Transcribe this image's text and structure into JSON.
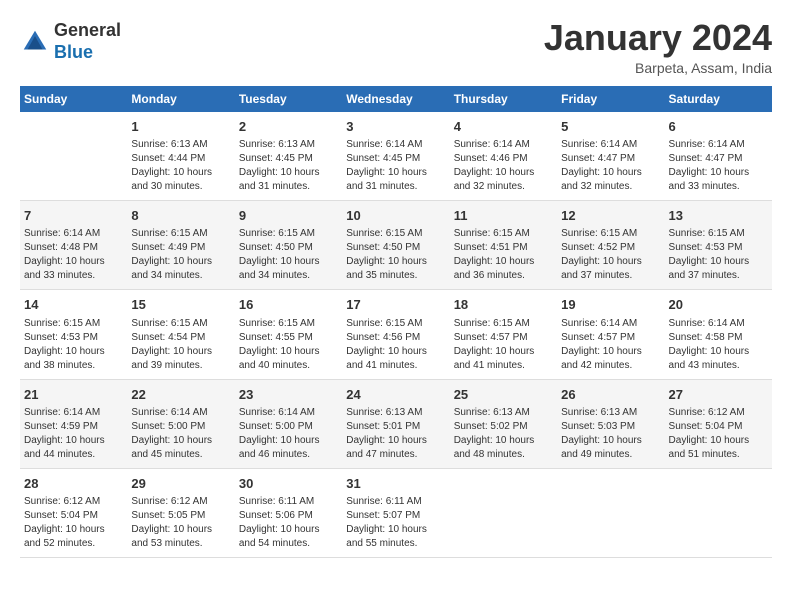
{
  "header": {
    "logo": {
      "general": "General",
      "blue": "Blue"
    },
    "title": "January 2024",
    "location": "Barpeta, Assam, India"
  },
  "calendar": {
    "days_of_week": [
      "Sunday",
      "Monday",
      "Tuesday",
      "Wednesday",
      "Thursday",
      "Friday",
      "Saturday"
    ],
    "weeks": [
      [
        {
          "day": "",
          "sunrise": "",
          "sunset": "",
          "daylight": ""
        },
        {
          "day": "1",
          "sunrise": "Sunrise: 6:13 AM",
          "sunset": "Sunset: 4:44 PM",
          "daylight": "Daylight: 10 hours and 30 minutes."
        },
        {
          "day": "2",
          "sunrise": "Sunrise: 6:13 AM",
          "sunset": "Sunset: 4:45 PM",
          "daylight": "Daylight: 10 hours and 31 minutes."
        },
        {
          "day": "3",
          "sunrise": "Sunrise: 6:14 AM",
          "sunset": "Sunset: 4:45 PM",
          "daylight": "Daylight: 10 hours and 31 minutes."
        },
        {
          "day": "4",
          "sunrise": "Sunrise: 6:14 AM",
          "sunset": "Sunset: 4:46 PM",
          "daylight": "Daylight: 10 hours and 32 minutes."
        },
        {
          "day": "5",
          "sunrise": "Sunrise: 6:14 AM",
          "sunset": "Sunset: 4:47 PM",
          "daylight": "Daylight: 10 hours and 32 minutes."
        },
        {
          "day": "6",
          "sunrise": "Sunrise: 6:14 AM",
          "sunset": "Sunset: 4:47 PM",
          "daylight": "Daylight: 10 hours and 33 minutes."
        }
      ],
      [
        {
          "day": "7",
          "sunrise": "Sunrise: 6:14 AM",
          "sunset": "Sunset: 4:48 PM",
          "daylight": "Daylight: 10 hours and 33 minutes."
        },
        {
          "day": "8",
          "sunrise": "Sunrise: 6:15 AM",
          "sunset": "Sunset: 4:49 PM",
          "daylight": "Daylight: 10 hours and 34 minutes."
        },
        {
          "day": "9",
          "sunrise": "Sunrise: 6:15 AM",
          "sunset": "Sunset: 4:50 PM",
          "daylight": "Daylight: 10 hours and 34 minutes."
        },
        {
          "day": "10",
          "sunrise": "Sunrise: 6:15 AM",
          "sunset": "Sunset: 4:50 PM",
          "daylight": "Daylight: 10 hours and 35 minutes."
        },
        {
          "day": "11",
          "sunrise": "Sunrise: 6:15 AM",
          "sunset": "Sunset: 4:51 PM",
          "daylight": "Daylight: 10 hours and 36 minutes."
        },
        {
          "day": "12",
          "sunrise": "Sunrise: 6:15 AM",
          "sunset": "Sunset: 4:52 PM",
          "daylight": "Daylight: 10 hours and 37 minutes."
        },
        {
          "day": "13",
          "sunrise": "Sunrise: 6:15 AM",
          "sunset": "Sunset: 4:53 PM",
          "daylight": "Daylight: 10 hours and 37 minutes."
        }
      ],
      [
        {
          "day": "14",
          "sunrise": "Sunrise: 6:15 AM",
          "sunset": "Sunset: 4:53 PM",
          "daylight": "Daylight: 10 hours and 38 minutes."
        },
        {
          "day": "15",
          "sunrise": "Sunrise: 6:15 AM",
          "sunset": "Sunset: 4:54 PM",
          "daylight": "Daylight: 10 hours and 39 minutes."
        },
        {
          "day": "16",
          "sunrise": "Sunrise: 6:15 AM",
          "sunset": "Sunset: 4:55 PM",
          "daylight": "Daylight: 10 hours and 40 minutes."
        },
        {
          "day": "17",
          "sunrise": "Sunrise: 6:15 AM",
          "sunset": "Sunset: 4:56 PM",
          "daylight": "Daylight: 10 hours and 41 minutes."
        },
        {
          "day": "18",
          "sunrise": "Sunrise: 6:15 AM",
          "sunset": "Sunset: 4:57 PM",
          "daylight": "Daylight: 10 hours and 41 minutes."
        },
        {
          "day": "19",
          "sunrise": "Sunrise: 6:14 AM",
          "sunset": "Sunset: 4:57 PM",
          "daylight": "Daylight: 10 hours and 42 minutes."
        },
        {
          "day": "20",
          "sunrise": "Sunrise: 6:14 AM",
          "sunset": "Sunset: 4:58 PM",
          "daylight": "Daylight: 10 hours and 43 minutes."
        }
      ],
      [
        {
          "day": "21",
          "sunrise": "Sunrise: 6:14 AM",
          "sunset": "Sunset: 4:59 PM",
          "daylight": "Daylight: 10 hours and 44 minutes."
        },
        {
          "day": "22",
          "sunrise": "Sunrise: 6:14 AM",
          "sunset": "Sunset: 5:00 PM",
          "daylight": "Daylight: 10 hours and 45 minutes."
        },
        {
          "day": "23",
          "sunrise": "Sunrise: 6:14 AM",
          "sunset": "Sunset: 5:00 PM",
          "daylight": "Daylight: 10 hours and 46 minutes."
        },
        {
          "day": "24",
          "sunrise": "Sunrise: 6:13 AM",
          "sunset": "Sunset: 5:01 PM",
          "daylight": "Daylight: 10 hours and 47 minutes."
        },
        {
          "day": "25",
          "sunrise": "Sunrise: 6:13 AM",
          "sunset": "Sunset: 5:02 PM",
          "daylight": "Daylight: 10 hours and 48 minutes."
        },
        {
          "day": "26",
          "sunrise": "Sunrise: 6:13 AM",
          "sunset": "Sunset: 5:03 PM",
          "daylight": "Daylight: 10 hours and 49 minutes."
        },
        {
          "day": "27",
          "sunrise": "Sunrise: 6:12 AM",
          "sunset": "Sunset: 5:04 PM",
          "daylight": "Daylight: 10 hours and 51 minutes."
        }
      ],
      [
        {
          "day": "28",
          "sunrise": "Sunrise: 6:12 AM",
          "sunset": "Sunset: 5:04 PM",
          "daylight": "Daylight: 10 hours and 52 minutes."
        },
        {
          "day": "29",
          "sunrise": "Sunrise: 6:12 AM",
          "sunset": "Sunset: 5:05 PM",
          "daylight": "Daylight: 10 hours and 53 minutes."
        },
        {
          "day": "30",
          "sunrise": "Sunrise: 6:11 AM",
          "sunset": "Sunset: 5:06 PM",
          "daylight": "Daylight: 10 hours and 54 minutes."
        },
        {
          "day": "31",
          "sunrise": "Sunrise: 6:11 AM",
          "sunset": "Sunset: 5:07 PM",
          "daylight": "Daylight: 10 hours and 55 minutes."
        },
        {
          "day": "",
          "sunrise": "",
          "sunset": "",
          "daylight": ""
        },
        {
          "day": "",
          "sunrise": "",
          "sunset": "",
          "daylight": ""
        },
        {
          "day": "",
          "sunrise": "",
          "sunset": "",
          "daylight": ""
        }
      ]
    ]
  }
}
